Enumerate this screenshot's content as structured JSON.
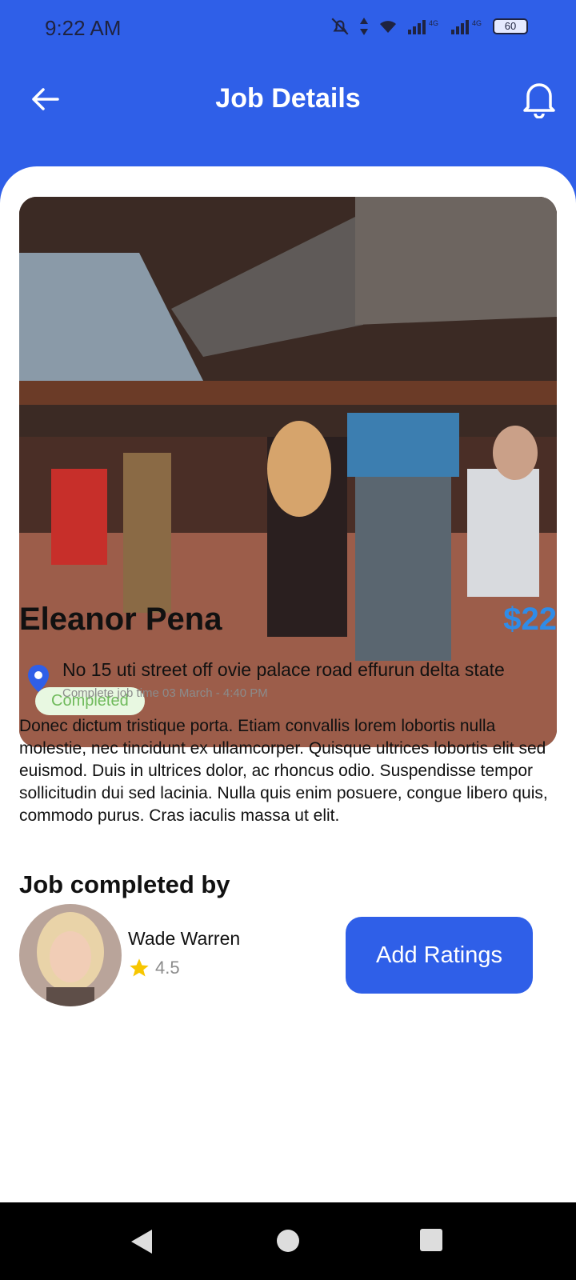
{
  "status": {
    "time": "9:22 AM",
    "battery": "60",
    "icons": [
      "mute-bell-icon",
      "data-arrows-icon",
      "wifi-icon",
      "signal-4g-icon",
      "signal-4g-icon",
      "battery-icon"
    ]
  },
  "header": {
    "title": "Job Details",
    "back_icon": "arrow-left-icon",
    "notification_icon": "bell-icon"
  },
  "job": {
    "status": "Completed",
    "customer_name": "Eleanor Pena",
    "price": "$22",
    "address": "No 15 uti street off ovie palace road effurun delta state",
    "complete_time": "Complete job time 03 March - 4:40 PM",
    "description": "Donec dictum tristique porta. Etiam convallis lorem lobortis nulla molestie, nec tincidunt ex ullamcorper. Quisque ultrices lobortis elit sed euismod. Duis in ultrices dolor, ac rhoncus odio. Suspendisse tempor sollicitudin dui sed lacinia. Nulla quis enim posuere, congue libero quis, commodo purus. Cras iaculis massa ut elit."
  },
  "completed_by": {
    "section_title": "Job completed by",
    "name": "Wade Warren",
    "rating": "4.5",
    "button_label": "Add Ratings"
  },
  "colors": {
    "primary": "#2F5FE8",
    "price": "#2F8CE8",
    "badge_bg": "#e8f8e1",
    "badge_text": "#6fba5b",
    "star": "#F7C600"
  }
}
